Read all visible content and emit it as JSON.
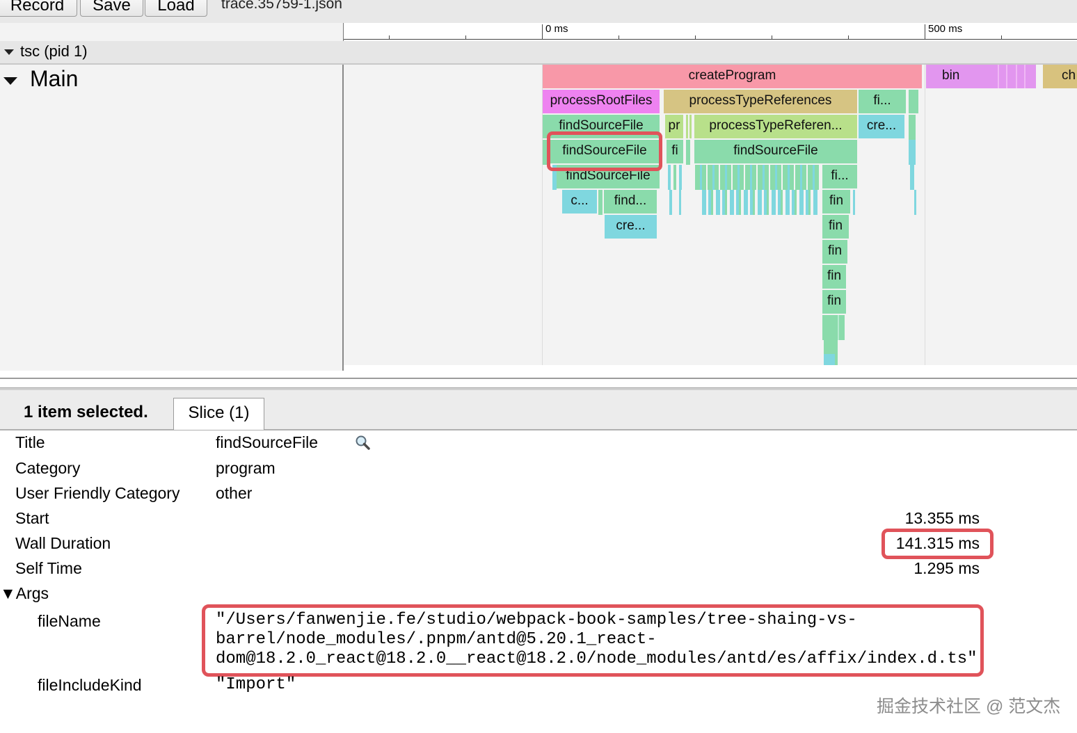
{
  "toolbar": {
    "record_label": "Record",
    "save_label": "Save",
    "load_label": "Load",
    "trace_name": "trace.35759-1.json"
  },
  "ruler": {
    "labels": [
      "0 ms",
      "500 ms"
    ]
  },
  "process": {
    "label": "tsc (pid 1)"
  },
  "thread": {
    "label": "Main"
  },
  "slices": {
    "createProgram": "createProgram",
    "bin": "bin",
    "ch": "ch",
    "processRootFiles": "processRootFiles",
    "processTypeReferences": "processTypeReferences",
    "fi_a": "fi...",
    "findSourceFile_1": "findSourceFile",
    "pr": "pr",
    "processTypeReferen": "processTypeReferen...",
    "cre_a": "cre...",
    "findSourceFile_selected": "findSourceFile",
    "fi_b": "fi",
    "findSourceFile_2": "findSourceFile",
    "findSourceFile_3": "findSourceFile",
    "fi_c": "fi...",
    "c": "c...",
    "find": "find...",
    "fin_1": "fin",
    "cre_b": "cre...",
    "fin_2": "fin",
    "fin_3": "fin",
    "fin_4": "fin",
    "fin_5": "fin"
  },
  "panel": {
    "selection_label": "1 item selected.",
    "tab_label": "Slice (1)"
  },
  "details": {
    "title_label": "Title",
    "title_value": "findSourceFile",
    "category_label": "Category",
    "category_value": "program",
    "ufc_label": "User Friendly Category",
    "ufc_value": "other",
    "start_label": "Start",
    "start_value": "13.355 ms",
    "wall_label": "Wall Duration",
    "wall_value": "141.315 ms",
    "self_label": "Self Time",
    "self_value": "1.295 ms",
    "args_label": "▼Args",
    "filename_label": "fileName",
    "filename_line1": "\"/Users/fanwenjie.fe/studio/webpack-book-samples/tree-shaing-vs-",
    "filename_line2": "barrel/node_modules/.pnpm/antd@5.20.1_react-",
    "filename_line3": "dom@18.2.0_react@18.2.0__react@18.2.0/node_modules/antd/es/affix/index.d.ts\"",
    "includekind_label": "fileIncludeKind",
    "includekind_value": "\"Import\""
  },
  "watermark": "掘金技术社区 @ 范文杰",
  "colors": {
    "createProgram": "#f898a8",
    "bin": "#e296ef",
    "ch": "#d8c27e",
    "processRootFiles": "#ee82f0",
    "processTypeReferences": "#d6c483",
    "findSourceFile": "#8adbab",
    "cyan": "#7fd7df",
    "lime": "#b8e08a",
    "highlight": "#e0535a"
  }
}
